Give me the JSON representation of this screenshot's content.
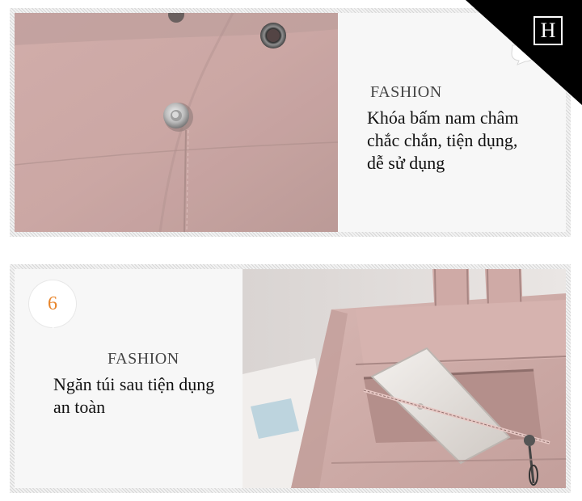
{
  "top_panel": {
    "label": "FASHION",
    "text": "Khóa bấm nam châm\nchắc chắn, tiện dụng,\ndễ sử dụng"
  },
  "bottom_panel": {
    "number": "6",
    "label": "FASHION",
    "text": "Ngăn túi sau tiện dụng\nan toàn"
  },
  "logo": {
    "letter": "H"
  },
  "colors": {
    "leather": "#c9a7a4",
    "number_accent": "#e8852b",
    "corner": "#000000"
  }
}
